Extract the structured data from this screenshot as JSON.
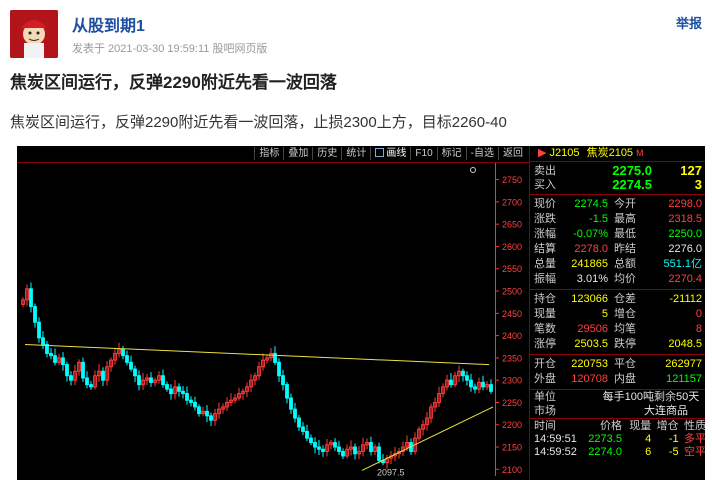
{
  "post": {
    "username": "从股到期1",
    "meta": "发表于 2021-03-30 19:59:11 股吧网页版",
    "report_label": "举报",
    "title": "焦炭区间运行，反弹2290附近先看一波回落",
    "body": "焦炭区间运行，反弹2290附近先看一波回落，止损2300上方，目标2260-40"
  },
  "chart": {
    "toolbar": [
      "指标",
      "叠加",
      "历史",
      "统计",
      "画线",
      "F10",
      "标记",
      "-自选",
      "返回"
    ],
    "toolbar_active": "画线",
    "y_ticks": [
      "2750",
      "2700",
      "2650",
      "2600",
      "2550",
      "2500",
      "2450",
      "2400",
      "2350",
      "2300",
      "2250",
      "2200",
      "2150",
      "2100"
    ],
    "low_label": "2097.5",
    "colors": {
      "up": "#ff3c3c",
      "down": "#00ffff",
      "trend": "#f0e040",
      "axis": "#ff3030"
    }
  },
  "chart_data": {
    "type": "candlestick",
    "title": "",
    "ylim": [
      2085,
      2785
    ],
    "closes": [
      2480,
      2505,
      2465,
      2430,
      2395,
      2380,
      2360,
      2355,
      2340,
      2350,
      2335,
      2310,
      2300,
      2320,
      2340,
      2305,
      2290,
      2285,
      2310,
      2320,
      2300,
      2330,
      2345,
      2360,
      2370,
      2355,
      2340,
      2325,
      2310,
      2290,
      2300,
      2305,
      2295,
      2300,
      2310,
      2290,
      2280,
      2270,
      2285,
      2275,
      2270,
      2255,
      2250,
      2240,
      2225,
      2230,
      2220,
      2210,
      2225,
      2235,
      2240,
      2250,
      2255,
      2260,
      2270,
      2275,
      2285,
      2300,
      2310,
      2330,
      2345,
      2350,
      2360,
      2340,
      2310,
      2290,
      2260,
      2235,
      2215,
      2195,
      2185,
      2170,
      2160,
      2150,
      2145,
      2140,
      2155,
      2160,
      2150,
      2140,
      2130,
      2145,
      2150,
      2135,
      2140,
      2155,
      2160,
      2140,
      2150,
      2120,
      2115,
      2125,
      2130,
      2135,
      2140,
      2150,
      2160,
      2140,
      2170,
      2190,
      2200,
      2215,
      2240,
      2250,
      2270,
      2285,
      2300,
      2290,
      2310,
      2320,
      2310,
      2300,
      2285,
      2280,
      2295,
      2285,
      2290,
      2275
    ],
    "resistance": {
      "start": 2380,
      "end": 2335
    },
    "support": {
      "start": 2097.5,
      "end": 2240
    },
    "low": 2097.5
  },
  "quote": {
    "code": "J2105",
    "name": "焦炭2105",
    "m": "M",
    "ask_label": "卖出",
    "ask_price": "2275.0",
    "ask_vol": "127",
    "bid_label": "买入",
    "bid_price": "2274.5",
    "bid_vol": "3",
    "stats1": [
      {
        "l1": "现价",
        "v1": "2274.5",
        "c1": "green",
        "l2": "今开",
        "v2": "2298.0",
        "c2": "red"
      },
      {
        "l1": "涨跌",
        "v1": "-1.5",
        "c1": "green",
        "l2": "最高",
        "v2": "2318.5",
        "c2": "red"
      },
      {
        "l1": "涨幅",
        "v1": "-0.07%",
        "c1": "green",
        "l2": "最低",
        "v2": "2250.0",
        "c2": "green"
      },
      {
        "l1": "结算",
        "v1": "2278.0",
        "c1": "red",
        "l2": "昨结",
        "v2": "2276.0",
        "c2": "white"
      },
      {
        "l1": "总量",
        "v1": "241865",
        "c1": "yellow",
        "l2": "总额",
        "v2": "551.1亿",
        "c2": "cyan"
      },
      {
        "l1": "振幅",
        "v1": "3.01%",
        "c1": "white",
        "l2": "均价",
        "v2": "2270.4",
        "c2": "red"
      }
    ],
    "stats2": [
      {
        "l1": "持仓",
        "v1": "123066",
        "c1": "yellow",
        "l2": "仓差",
        "v2": "-21112",
        "c2": "yellow"
      },
      {
        "l1": "现量",
        "v1": "5",
        "c1": "yellow",
        "l2": "增仓",
        "v2": "0",
        "c2": "red"
      },
      {
        "l1": "笔数",
        "v1": "29506",
        "c1": "red",
        "l2": "均笔",
        "v2": "8",
        "c2": "red"
      },
      {
        "l1": "涨停",
        "v1": "2503.5",
        "c1": "yellow",
        "l2": "跌停",
        "v2": "2048.5",
        "c2": "yellow"
      }
    ],
    "stats3": [
      {
        "l1": "开仓",
        "v1": "220753",
        "c1": "yellow",
        "l2": "平仓",
        "v2": "262977",
        "c2": "yellow"
      },
      {
        "l1": "外盘",
        "v1": "120708",
        "c1": "red",
        "l2": "内盘",
        "v2": "121157",
        "c2": "green"
      }
    ],
    "unit_label": "单位",
    "unit_value": "每手100吨",
    "remain_label": "剩余",
    "remain_value": "50天",
    "market_label": "市场",
    "market_value": "大连商品",
    "tick_headers": [
      "时间",
      "价格",
      "现量",
      "增仓",
      "性质"
    ],
    "ticks": [
      {
        "time": "14:59:51",
        "price": "2273.5",
        "vol": "4",
        "chg": "-1",
        "nature": "多平",
        "nc": "red"
      },
      {
        "time": "14:59:52",
        "price": "2274.0",
        "vol": "6",
        "chg": "-5",
        "nature": "空平",
        "nc": "red"
      }
    ]
  }
}
